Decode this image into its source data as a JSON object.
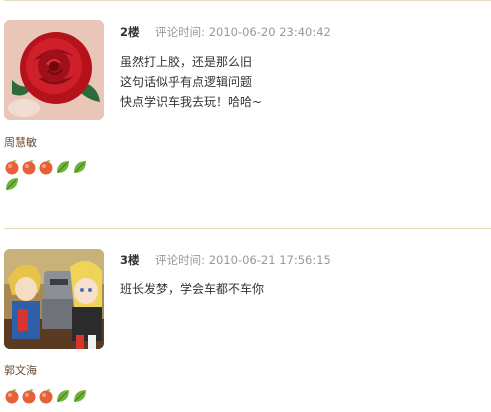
{
  "comments": [
    {
      "floor": "2楼",
      "time_label": "评论时间:",
      "time": "2010-06-20 23:40:42",
      "username": "周慧敏",
      "avatar_icon": "rose-avatar",
      "lines": [
        "虽然打上胶，还是那么旧",
        "这句话似乎有点逻辑问题",
        "快点学识车我去玩！哈哈~"
      ],
      "badges": [
        "peach-icon",
        "peach-icon",
        "peach-icon",
        "leaf-icon",
        "leaf-icon",
        "leaf-icon"
      ]
    },
    {
      "floor": "3楼",
      "time_label": "评论时间:",
      "time": "2010-06-21 17:56:15",
      "username": "郭文海",
      "avatar_icon": "anime-characters-avatar",
      "lines": [
        "班长发梦，学会车都不车你"
      ],
      "badges": [
        "peach-icon",
        "peach-icon",
        "peach-icon",
        "leaf-icon",
        "leaf-icon"
      ]
    }
  ],
  "colors": {
    "divider": "#e8dcc0",
    "username": "#6b4a2a",
    "meta": "#999999",
    "peach": "#e8603a",
    "leaf": "#6fb33a"
  }
}
